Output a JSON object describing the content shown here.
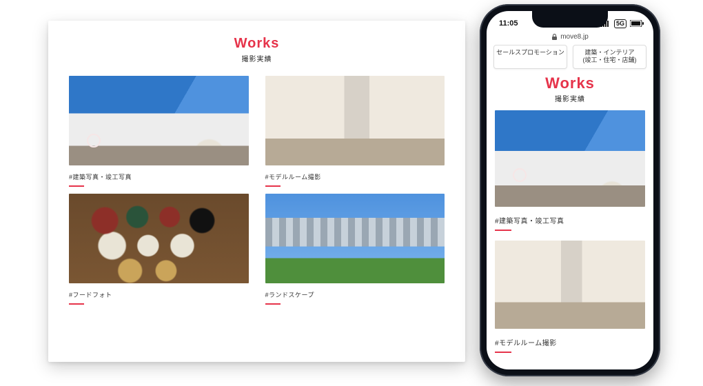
{
  "colors": {
    "accent": "#e6334a"
  },
  "desktop": {
    "title": "Works",
    "subtitle": "撮影実績",
    "cards": [
      {
        "caption": "#建築写真・竣工写真"
      },
      {
        "caption": "#モデルルーム撮影"
      },
      {
        "caption": "#フードフォト"
      },
      {
        "caption": "#ランドスケープ"
      }
    ]
  },
  "phone": {
    "status_time": "11:05",
    "network_label": "5G",
    "url_host": "move8.jp",
    "pills": [
      "セールスプロモーション",
      "建築・インテリア\n(竣工・住宅・店舗)"
    ],
    "title": "Works",
    "subtitle": "撮影実績",
    "cards": [
      {
        "caption": "#建築写真・竣工写真"
      },
      {
        "caption": "#モデルルーム撮影"
      }
    ]
  }
}
